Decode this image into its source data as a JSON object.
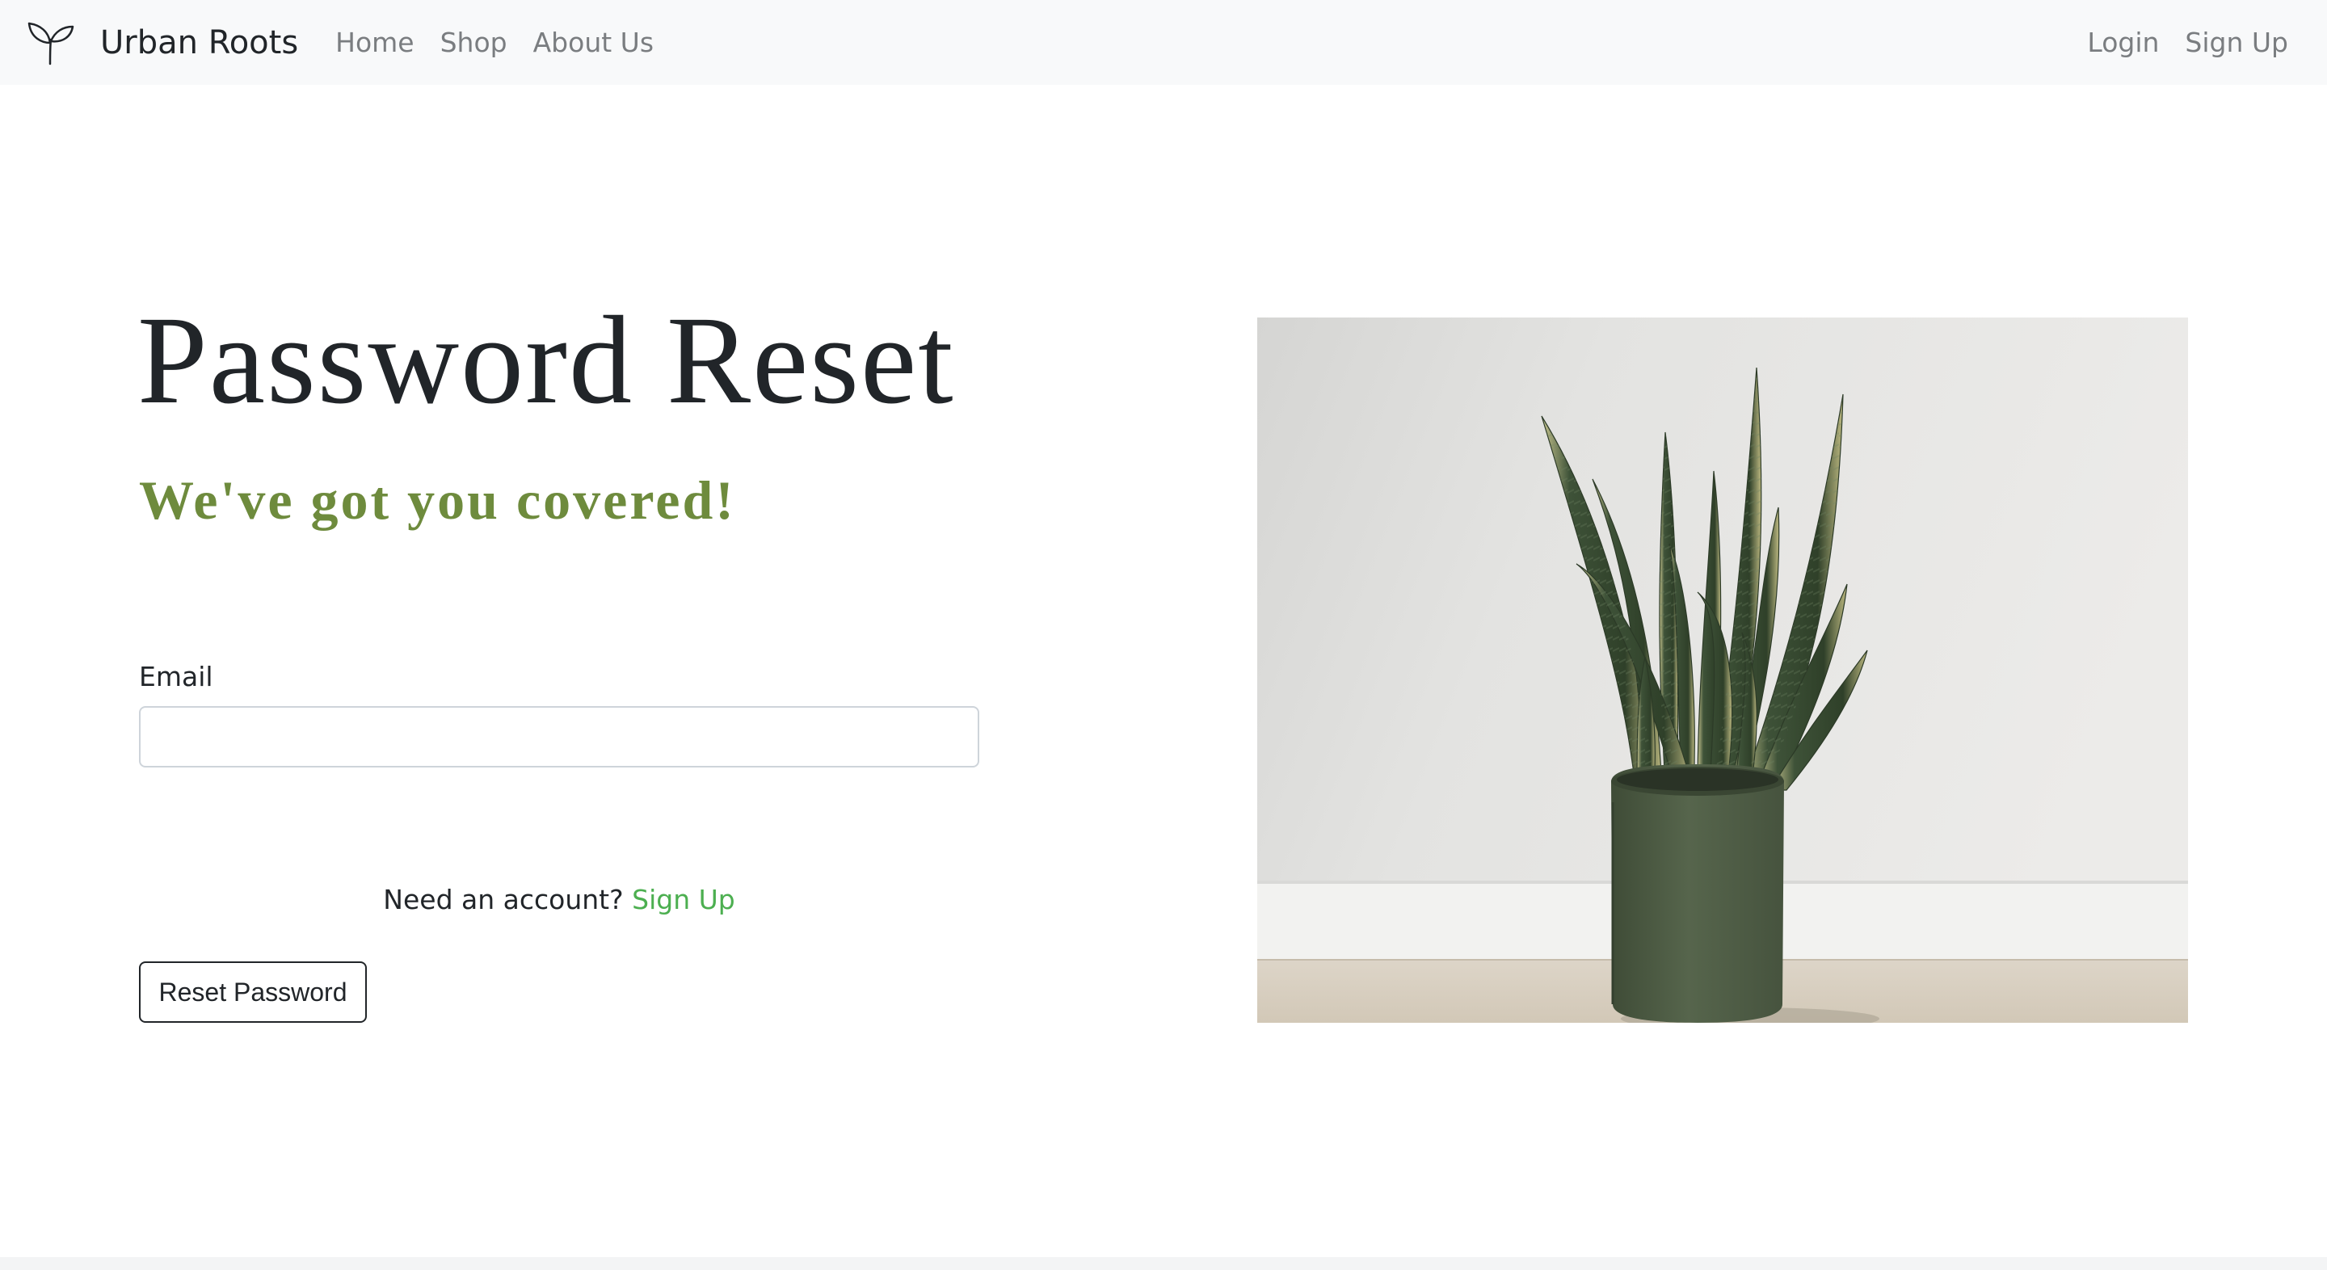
{
  "navbar": {
    "brand": "Urban Roots",
    "brand_icon": "sprout-icon",
    "links": [
      "Home",
      "Shop",
      "About Us"
    ],
    "right_links": [
      "Login",
      "Sign Up"
    ]
  },
  "main": {
    "title": "Password Reset",
    "subtitle": "We've got you covered!",
    "email_label": "Email",
    "email_value": "",
    "account_prompt": "Need an account?",
    "signup_link": "Sign Up",
    "reset_button": "Reset Password"
  },
  "colors": {
    "navbar_bg": "#f8f9fa",
    "subtitle_green": "#6e8b3d",
    "link_green": "#4caf50",
    "pot_green": "#4f5e46"
  }
}
